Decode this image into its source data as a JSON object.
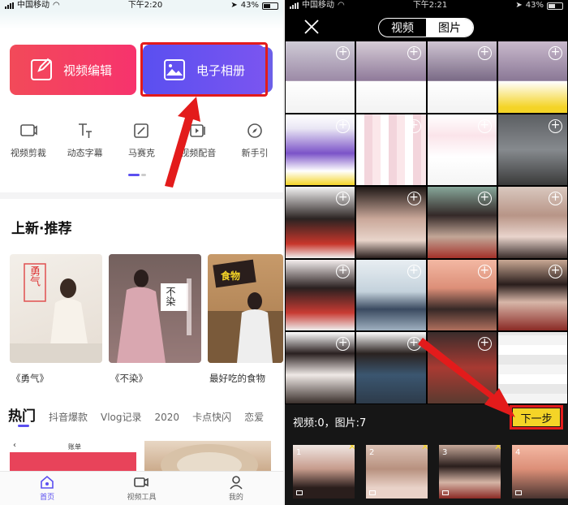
{
  "left": {
    "status": {
      "carrier": "中国移动",
      "time": "下午2:20",
      "battery": "43%"
    },
    "buttons": {
      "video_edit": "视频编辑",
      "album": "电子相册"
    },
    "tools": [
      {
        "label": "视频剪裁",
        "icon": "video-crop-icon"
      },
      {
        "label": "动态字幕",
        "icon": "text-icon"
      },
      {
        "label": "马赛克",
        "icon": "mosaic-icon"
      },
      {
        "label": "视频配音",
        "icon": "dubbing-icon"
      },
      {
        "label": "新手引",
        "icon": "compass-icon"
      }
    ],
    "section_title": "上新·推荐",
    "cards": [
      {
        "title": "《勇气》",
        "overlay": "勇气"
      },
      {
        "title": "《不染》",
        "overlay": "不染"
      },
      {
        "title": "最好吃的食物",
        "overlay": "食物"
      }
    ],
    "tabs": [
      "热门",
      "抖音爆款",
      "Vlog记录",
      "2020",
      "卡点快闪",
      "恋爱"
    ],
    "bottom_thumb_text": "账单",
    "nav": [
      {
        "label": "首页",
        "icon": "home-icon"
      },
      {
        "label": "视频工具",
        "icon": "video-tool-icon"
      },
      {
        "label": "我的",
        "icon": "profile-icon"
      }
    ],
    "colors": {
      "video_btn": "#f24a59",
      "album_btn": "#5a4ff0",
      "accent": "#5b4ff0",
      "highlight": "#e31b1b"
    }
  },
  "right": {
    "status": {
      "carrier": "中国移动",
      "time": "下午2:21",
      "battery": "43%"
    },
    "segment": {
      "video": "视频",
      "image": "图片"
    },
    "selection_count": "视频:0，图片:7",
    "next_button": "下一步",
    "selected_numbers": [
      "1",
      "2",
      "3",
      "4"
    ],
    "colors": {
      "next_btn": "#f4d427"
    }
  }
}
